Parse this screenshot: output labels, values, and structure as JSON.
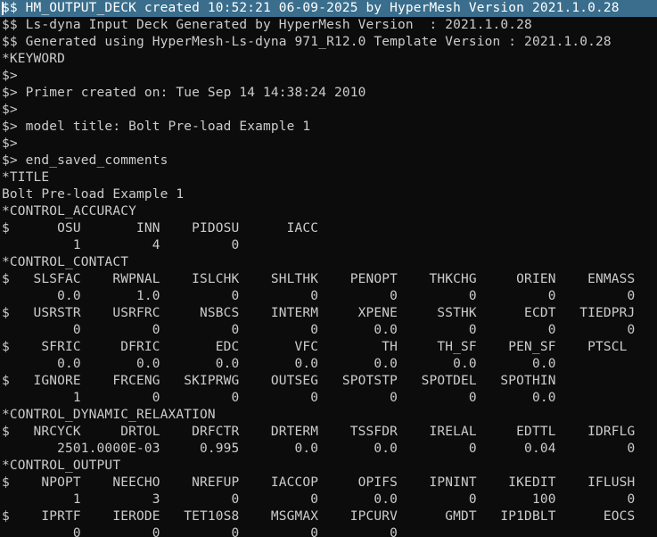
{
  "editor": {
    "background": "#0c0c0c",
    "text_color": "#cccccc",
    "selection_color": "#3a6e8c",
    "selected_line_index": 0,
    "lines": [
      "$$ HM_OUTPUT_DECK created 10:52:21 06-09-2025 by HyperMesh Version 2021.1.0.28",
      "$$ Ls-dyna Input Deck Generated by HyperMesh Version  : 2021.1.0.28",
      "$$ Generated using HyperMesh-Ls-dyna 971_R12.0 Template Version : 2021.1.0.28",
      "*KEYWORD",
      "$>",
      "$> Primer created on: Tue Sep 14 14:38:24 2010",
      "$>",
      "$> model title: Bolt Pre-load Example 1",
      "$>",
      "$> end_saved_comments",
      "*TITLE",
      "Bolt Pre-load Example 1",
      "*CONTROL_ACCURACY",
      "$      OSU       INN    PIDOSU      IACC",
      "         1         4         0",
      "*CONTROL_CONTACT",
      "$   SLSFAC    RWPNAL    ISLCHK    SHLTHK    PENOPT    THKCHG     ORIEN    ENMASS",
      "       0.0       1.0         0         0         0         0         0         0",
      "$   USRSTR    USRFRC     NSBCS    INTERM     XPENE     SSTHK      ECDT   TIEDPRJ",
      "         0         0         0         0       0.0         0         0         0",
      "$    SFRIC     DFRIC       EDC       VFC        TH     TH_SF    PEN_SF    PTSCL",
      "       0.0       0.0       0.0       0.0       0.0       0.0       0.0",
      "$   IGNORE    FRCENG   SKIPRWG    OUTSEG   SPOTSTP   SPOTDEL   SPOTHIN",
      "         1         0         0         0         0         0       0.0",
      "*CONTROL_DYNAMIC_RELAXATION",
      "$   NRCYCK     DRTOL    DRFCTR    DRTERM    TSSFDR    IRELAL     EDTTL    IDRFLG",
      "       2501.0000E-03     0.995       0.0       0.0         0      0.04         0",
      "*CONTROL_OUTPUT",
      "$    NPOPT    NEECHO    NREFUP    IACCOP     OPIFS    IPNINT    IKEDIT    IFLUSH",
      "         1         3         0         0       0.0         0       100         0",
      "$    IPRTF    IERODE   TET10S8    MSGMAX    IPCURV      GMDT   IP1DBLT      EOCS",
      "         0         0         0         0         0"
    ]
  }
}
